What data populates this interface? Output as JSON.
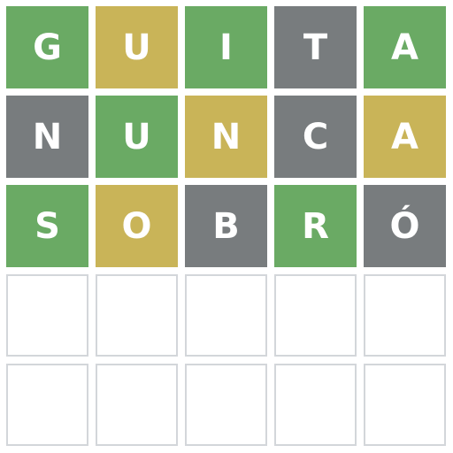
{
  "colors": {
    "correct": "#6aaa64",
    "present": "#c9b458",
    "absent": "#787c7e",
    "empty_border": "#d3d6da"
  },
  "board": {
    "rows": [
      {
        "tiles": [
          {
            "letter": "G",
            "state": "correct"
          },
          {
            "letter": "U",
            "state": "present"
          },
          {
            "letter": "I",
            "state": "correct"
          },
          {
            "letter": "T",
            "state": "absent"
          },
          {
            "letter": "A",
            "state": "correct"
          }
        ]
      },
      {
        "tiles": [
          {
            "letter": "N",
            "state": "absent"
          },
          {
            "letter": "U",
            "state": "correct"
          },
          {
            "letter": "N",
            "state": "present"
          },
          {
            "letter": "C",
            "state": "absent"
          },
          {
            "letter": "A",
            "state": "present"
          }
        ]
      },
      {
        "tiles": [
          {
            "letter": "S",
            "state": "correct"
          },
          {
            "letter": "O",
            "state": "present"
          },
          {
            "letter": "B",
            "state": "absent"
          },
          {
            "letter": "R",
            "state": "correct"
          },
          {
            "letter": "Ó",
            "state": "absent"
          }
        ]
      },
      {
        "tiles": [
          {
            "letter": "",
            "state": "empty"
          },
          {
            "letter": "",
            "state": "empty"
          },
          {
            "letter": "",
            "state": "empty"
          },
          {
            "letter": "",
            "state": "empty"
          },
          {
            "letter": "",
            "state": "empty"
          }
        ]
      },
      {
        "tiles": [
          {
            "letter": "",
            "state": "empty"
          },
          {
            "letter": "",
            "state": "empty"
          },
          {
            "letter": "",
            "state": "empty"
          },
          {
            "letter": "",
            "state": "empty"
          },
          {
            "letter": "",
            "state": "empty"
          }
        ]
      }
    ]
  }
}
